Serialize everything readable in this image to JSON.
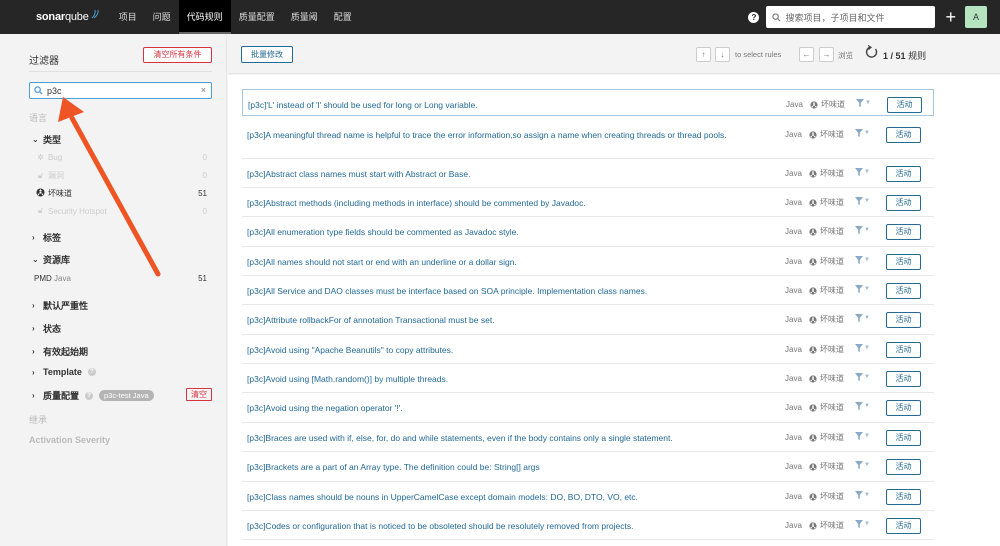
{
  "topbar": {
    "logo_bold": "sonar",
    "logo_light": "qube",
    "nav": [
      "项目",
      "问题",
      "代码规则",
      "质量配置",
      "质量阈",
      "配置"
    ],
    "active_nav_index": 2,
    "search_placeholder": "搜索项目，子项目和文件",
    "help_icon": "?",
    "add_icon": "+",
    "avatar_letter": "A"
  },
  "sidebar": {
    "title": "过滤器",
    "clear_all": "清空所有条件",
    "search_value": "p3c",
    "search_clear": "×",
    "language_label": "语言",
    "type_facet": {
      "label": "类型",
      "expanded": true,
      "items": [
        {
          "label": "Bug",
          "count": "0",
          "icon": "bug-icon",
          "enabled": false
        },
        {
          "label": "漏洞",
          "count": "0",
          "icon": "lock-icon",
          "enabled": false
        },
        {
          "label": "坏味道",
          "count": "51",
          "icon": "code-smell-icon",
          "enabled": true
        },
        {
          "label": "Security Hotspot",
          "count": "0",
          "icon": "lock-icon",
          "enabled": false
        }
      ]
    },
    "tags_facet": {
      "label": "标签",
      "expanded": false
    },
    "repo_facet": {
      "label": "资源库",
      "expanded": true,
      "items": [
        {
          "label_bold": "PMD",
          "label_light": "Java",
          "count": "51"
        }
      ]
    },
    "severity_facet": {
      "label": "默认严重性",
      "expanded": false
    },
    "status_facet": {
      "label": "状态",
      "expanded": false
    },
    "available_since_facet": {
      "label": "有效起始期",
      "expanded": false
    },
    "template_facet": {
      "label": "Template",
      "expanded": false
    },
    "profile_facet": {
      "label": "质量配置",
      "expanded": false,
      "selected": "p3c-test Java",
      "clear": "清空"
    },
    "inheritance_label": "继承",
    "activation_severity_label": "Activation Severity"
  },
  "toolbar": {
    "bulk_change": "批量修改",
    "up_key": "↑",
    "down_key": "↓",
    "select_hint": "to select rules",
    "left_key": "←",
    "right_key": "→",
    "browse_hint": "浏览",
    "count_current": "1",
    "count_total": "51",
    "count_unit": "规则"
  },
  "rules": [
    {
      "name": "[p3c]'L' instead of 'l' should be used for long or Long variable.",
      "lang": "Java",
      "type": "坏味道",
      "action": "活动",
      "selected": true
    },
    {
      "name": "[p3c]A meaningful thread name is helpful to trace the error information,so assign a name when creating threads or thread pools.",
      "lang": "Java",
      "type": "坏味道",
      "action": "活动",
      "selected": false
    },
    {
      "name": "[p3c]Abstract class names must start with Abstract or Base.",
      "lang": "Java",
      "type": "坏味道",
      "action": "活动",
      "selected": false
    },
    {
      "name": "[p3c]Abstract methods (including methods in interface) should be commented by Javadoc.",
      "lang": "Java",
      "type": "坏味道",
      "action": "活动",
      "selected": false
    },
    {
      "name": "[p3c]All enumeration type fields should be commented as Javadoc style.",
      "lang": "Java",
      "type": "坏味道",
      "action": "活动",
      "selected": false
    },
    {
      "name": "[p3c]All names should not start or end with an underline or a dollar sign.",
      "lang": "Java",
      "type": "坏味道",
      "action": "活动",
      "selected": false
    },
    {
      "name": "[p3c]All Service and DAO classes must be interface based on SOA principle. Implementation class names.",
      "lang": "Java",
      "type": "坏味道",
      "action": "活动",
      "selected": false
    },
    {
      "name": "[p3c]Attribute rollbackFor of annotation Transactional must be set.",
      "lang": "Java",
      "type": "坏味道",
      "action": "活动",
      "selected": false
    },
    {
      "name": "[p3c]Avoid using \"Apache Beanutils\" to copy attributes.",
      "lang": "Java",
      "type": "坏味道",
      "action": "活动",
      "selected": false
    },
    {
      "name": "[p3c]Avoid using [Math.random()] by multiple threads.",
      "lang": "Java",
      "type": "坏味道",
      "action": "活动",
      "selected": false
    },
    {
      "name": "[p3c]Avoid using the negation operator '!'.",
      "lang": "Java",
      "type": "坏味道",
      "action": "活动",
      "selected": false
    },
    {
      "name": "[p3c]Braces are used with if, else, for, do and while statements, even if the body contains only a single statement.",
      "lang": "Java",
      "type": "坏味道",
      "action": "活动",
      "selected": false
    },
    {
      "name": "[p3c]Brackets are a part of an Array type. The definition could be: String[] args",
      "lang": "Java",
      "type": "坏味道",
      "action": "活动",
      "selected": false
    },
    {
      "name": "[p3c]Class names should be nouns in UpperCamelCase except domain models: DO, BO, DTO, VO, etc.",
      "lang": "Java",
      "type": "坏味道",
      "action": "活动",
      "selected": false
    },
    {
      "name": "[p3c]Codes or configuration that is noticed to be obsoleted should be resolutely removed from projects.",
      "lang": "Java",
      "type": "坏味道",
      "action": "活动",
      "selected": false
    }
  ],
  "colors": {
    "topbar_bg": "#262626",
    "link_blue": "#236a97",
    "danger_red": "#d4333f",
    "annotation_arrow": "#ee5424"
  }
}
